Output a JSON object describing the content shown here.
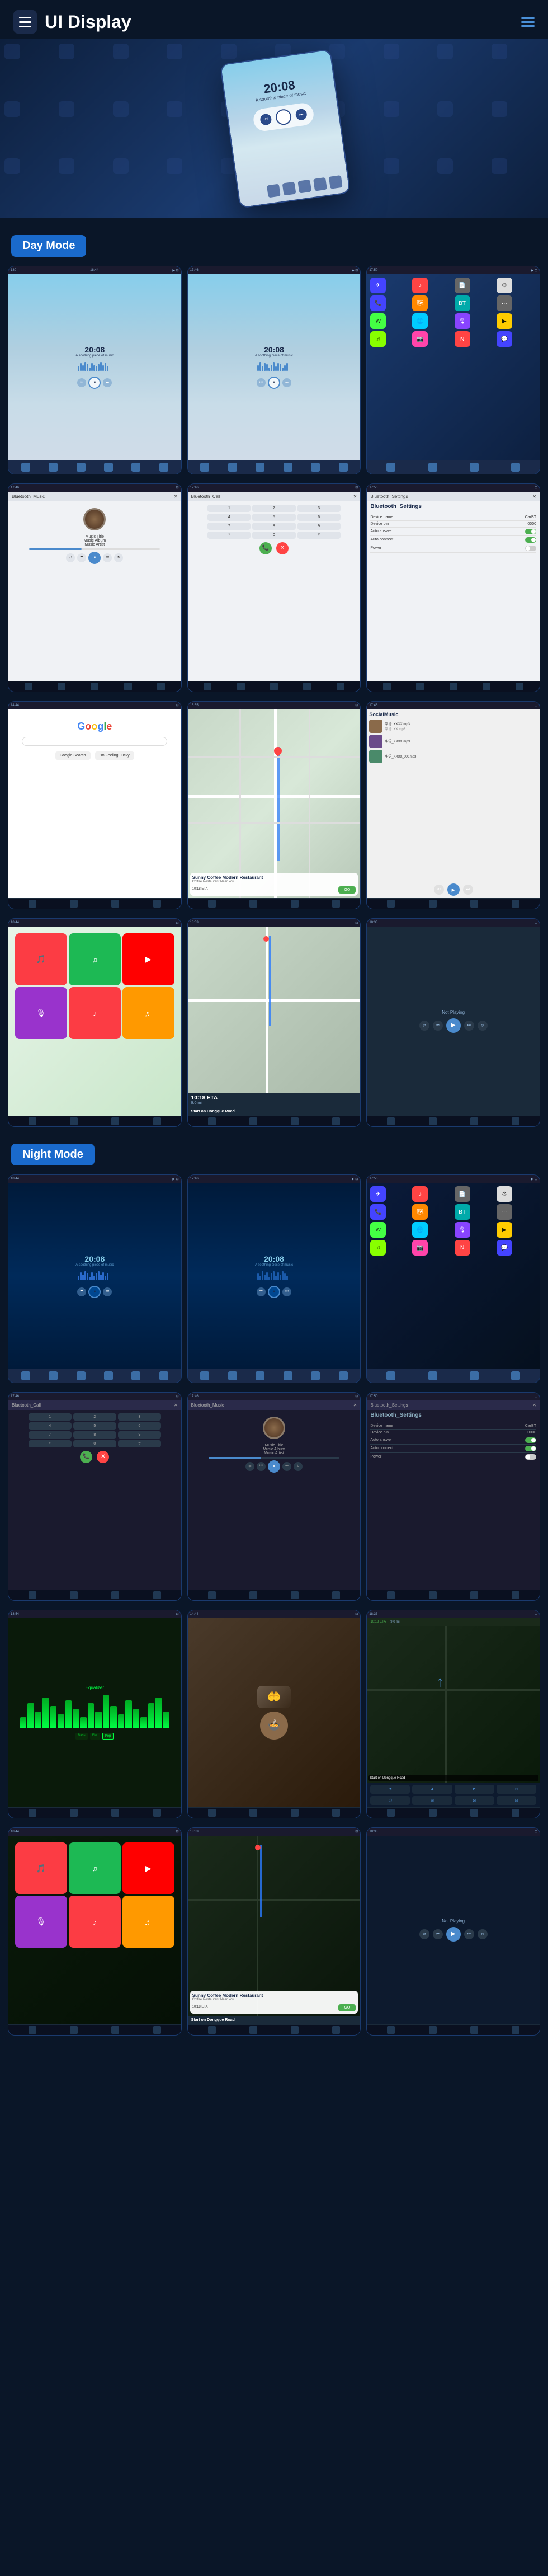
{
  "header": {
    "title": "UI Display",
    "menu_label": "menu",
    "lines_label": "lines"
  },
  "sections": {
    "day_mode": {
      "label": "Day Mode"
    },
    "night_mode": {
      "label": "Night Mode"
    }
  },
  "day_screens": {
    "row1": [
      {
        "id": "day-music-1",
        "type": "car",
        "time": "20:08",
        "subtitle": "A soothing piece of music"
      },
      {
        "id": "day-music-2",
        "type": "car",
        "time": "20:08",
        "subtitle": "A soothing piece of music"
      },
      {
        "id": "day-apps",
        "type": "apps"
      }
    ],
    "row2": [
      {
        "id": "day-bt-music",
        "type": "bluetooth_music",
        "title": "Bluetooth_Music"
      },
      {
        "id": "day-bt-call",
        "type": "bluetooth_call",
        "title": "Bluetooth_Call"
      },
      {
        "id": "day-bt-settings",
        "type": "bluetooth_settings",
        "title": "Bluetooth_Settings"
      }
    ],
    "row3": [
      {
        "id": "day-google",
        "type": "google"
      },
      {
        "id": "day-map",
        "type": "map"
      },
      {
        "id": "day-social",
        "type": "social"
      }
    ],
    "row4": [
      {
        "id": "day-media-apps",
        "type": "media_apps"
      },
      {
        "id": "day-nav",
        "type": "navigation"
      },
      {
        "id": "day-notplay",
        "type": "not_playing"
      }
    ]
  },
  "night_screens": {
    "row1": [
      {
        "id": "night-music-1",
        "type": "car_dark",
        "time": "20:08",
        "subtitle": "A soothing piece of music"
      },
      {
        "id": "night-music-2",
        "type": "car_dark",
        "time": "20:08",
        "subtitle": "A soothing piece of music"
      },
      {
        "id": "night-apps",
        "type": "apps_dark"
      }
    ],
    "row2": [
      {
        "id": "night-bt-call",
        "type": "bluetooth_call_dark",
        "title": "Bluetooth_Call"
      },
      {
        "id": "night-bt-music",
        "type": "bluetooth_music_dark",
        "title": "Bluetooth_Music"
      },
      {
        "id": "night-bt-settings",
        "type": "bluetooth_settings_dark",
        "title": "Bluetooth_Settings"
      }
    ],
    "row3": [
      {
        "id": "night-eq",
        "type": "equalizer"
      },
      {
        "id": "night-food",
        "type": "food"
      },
      {
        "id": "night-tbt",
        "type": "tbt"
      }
    ],
    "row4": [
      {
        "id": "night-media-apps",
        "type": "media_apps_dark"
      },
      {
        "id": "night-nav",
        "type": "navigation_dark"
      },
      {
        "id": "night-notplay",
        "type": "not_playing_dark"
      }
    ]
  },
  "music_info": {
    "title": "Music Title",
    "album": "Music Album",
    "artist": "Music Artist"
  },
  "bt_settings": {
    "device_name_label": "Device name",
    "device_name_value": "CarBT",
    "device_pin_label": "Device pin",
    "device_pin_value": "0000",
    "auto_answer_label": "Auto answer",
    "auto_connect_label": "Auto connect",
    "power_label": "Power"
  },
  "poi": {
    "name": "Sunny Coffee Modern Restaurant",
    "address": "Coffee Restaurant Near You",
    "eta_time": "10:18 ETA",
    "distance": "9.0 mi",
    "go_label": "GO"
  },
  "nav": {
    "eta": "10:18 ETA",
    "distance": "9.0 mi",
    "road": "Start on Dongque Road",
    "not_playing": "Not Playing"
  },
  "keys": [
    "1",
    "2",
    "3",
    "4",
    "5",
    "6",
    "7",
    "8",
    "9",
    "*",
    "0",
    "#"
  ],
  "colors": {
    "accent": "#1a6acc",
    "bg_dark": "#0a1628",
    "bg_light": "#f0f2f5",
    "green": "#4CAF50",
    "blue": "#4a8acc"
  }
}
